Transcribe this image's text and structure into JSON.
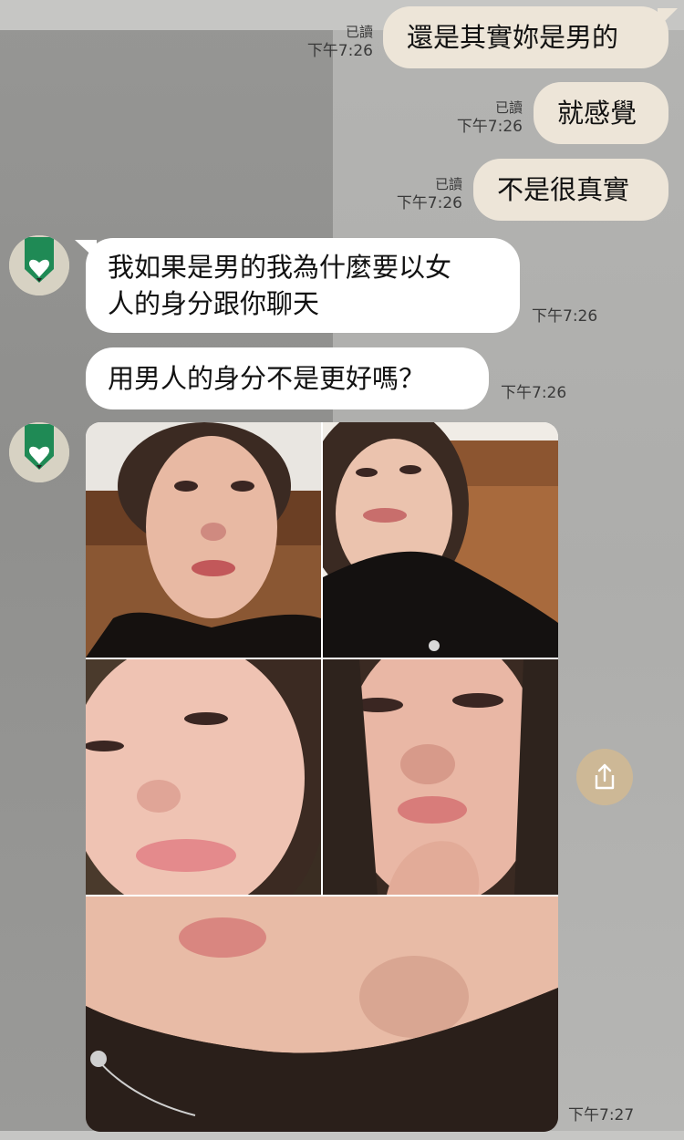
{
  "chat": {
    "outgoing": [
      {
        "text": "還是其實妳是男的",
        "read": "已讀",
        "time": "下午7:26"
      },
      {
        "text": "就感覺",
        "read": "已讀",
        "time": "下午7:26"
      },
      {
        "text": "不是很真實",
        "read": "已讀",
        "time": "下午7:26"
      }
    ],
    "incoming": [
      {
        "line1": "我如果是男的我為什麼要以女",
        "line2": "人的身分跟你聊天",
        "time": "下午7:26"
      },
      {
        "text": "用男人的身分不是更好嗎？",
        "time": "下午7:26"
      }
    ],
    "photo_album": {
      "photo_count": 5,
      "time": "下午7:27"
    }
  },
  "icons": {
    "avatar": "green-pencil-heart-avatar-icon",
    "share": "share-upload-icon"
  },
  "colors": {
    "outgoing_bubble": "#ede5d8",
    "incoming_bubble": "#ffffff",
    "share_button": "#cdb896",
    "avatar_green": "#1f8a55"
  }
}
